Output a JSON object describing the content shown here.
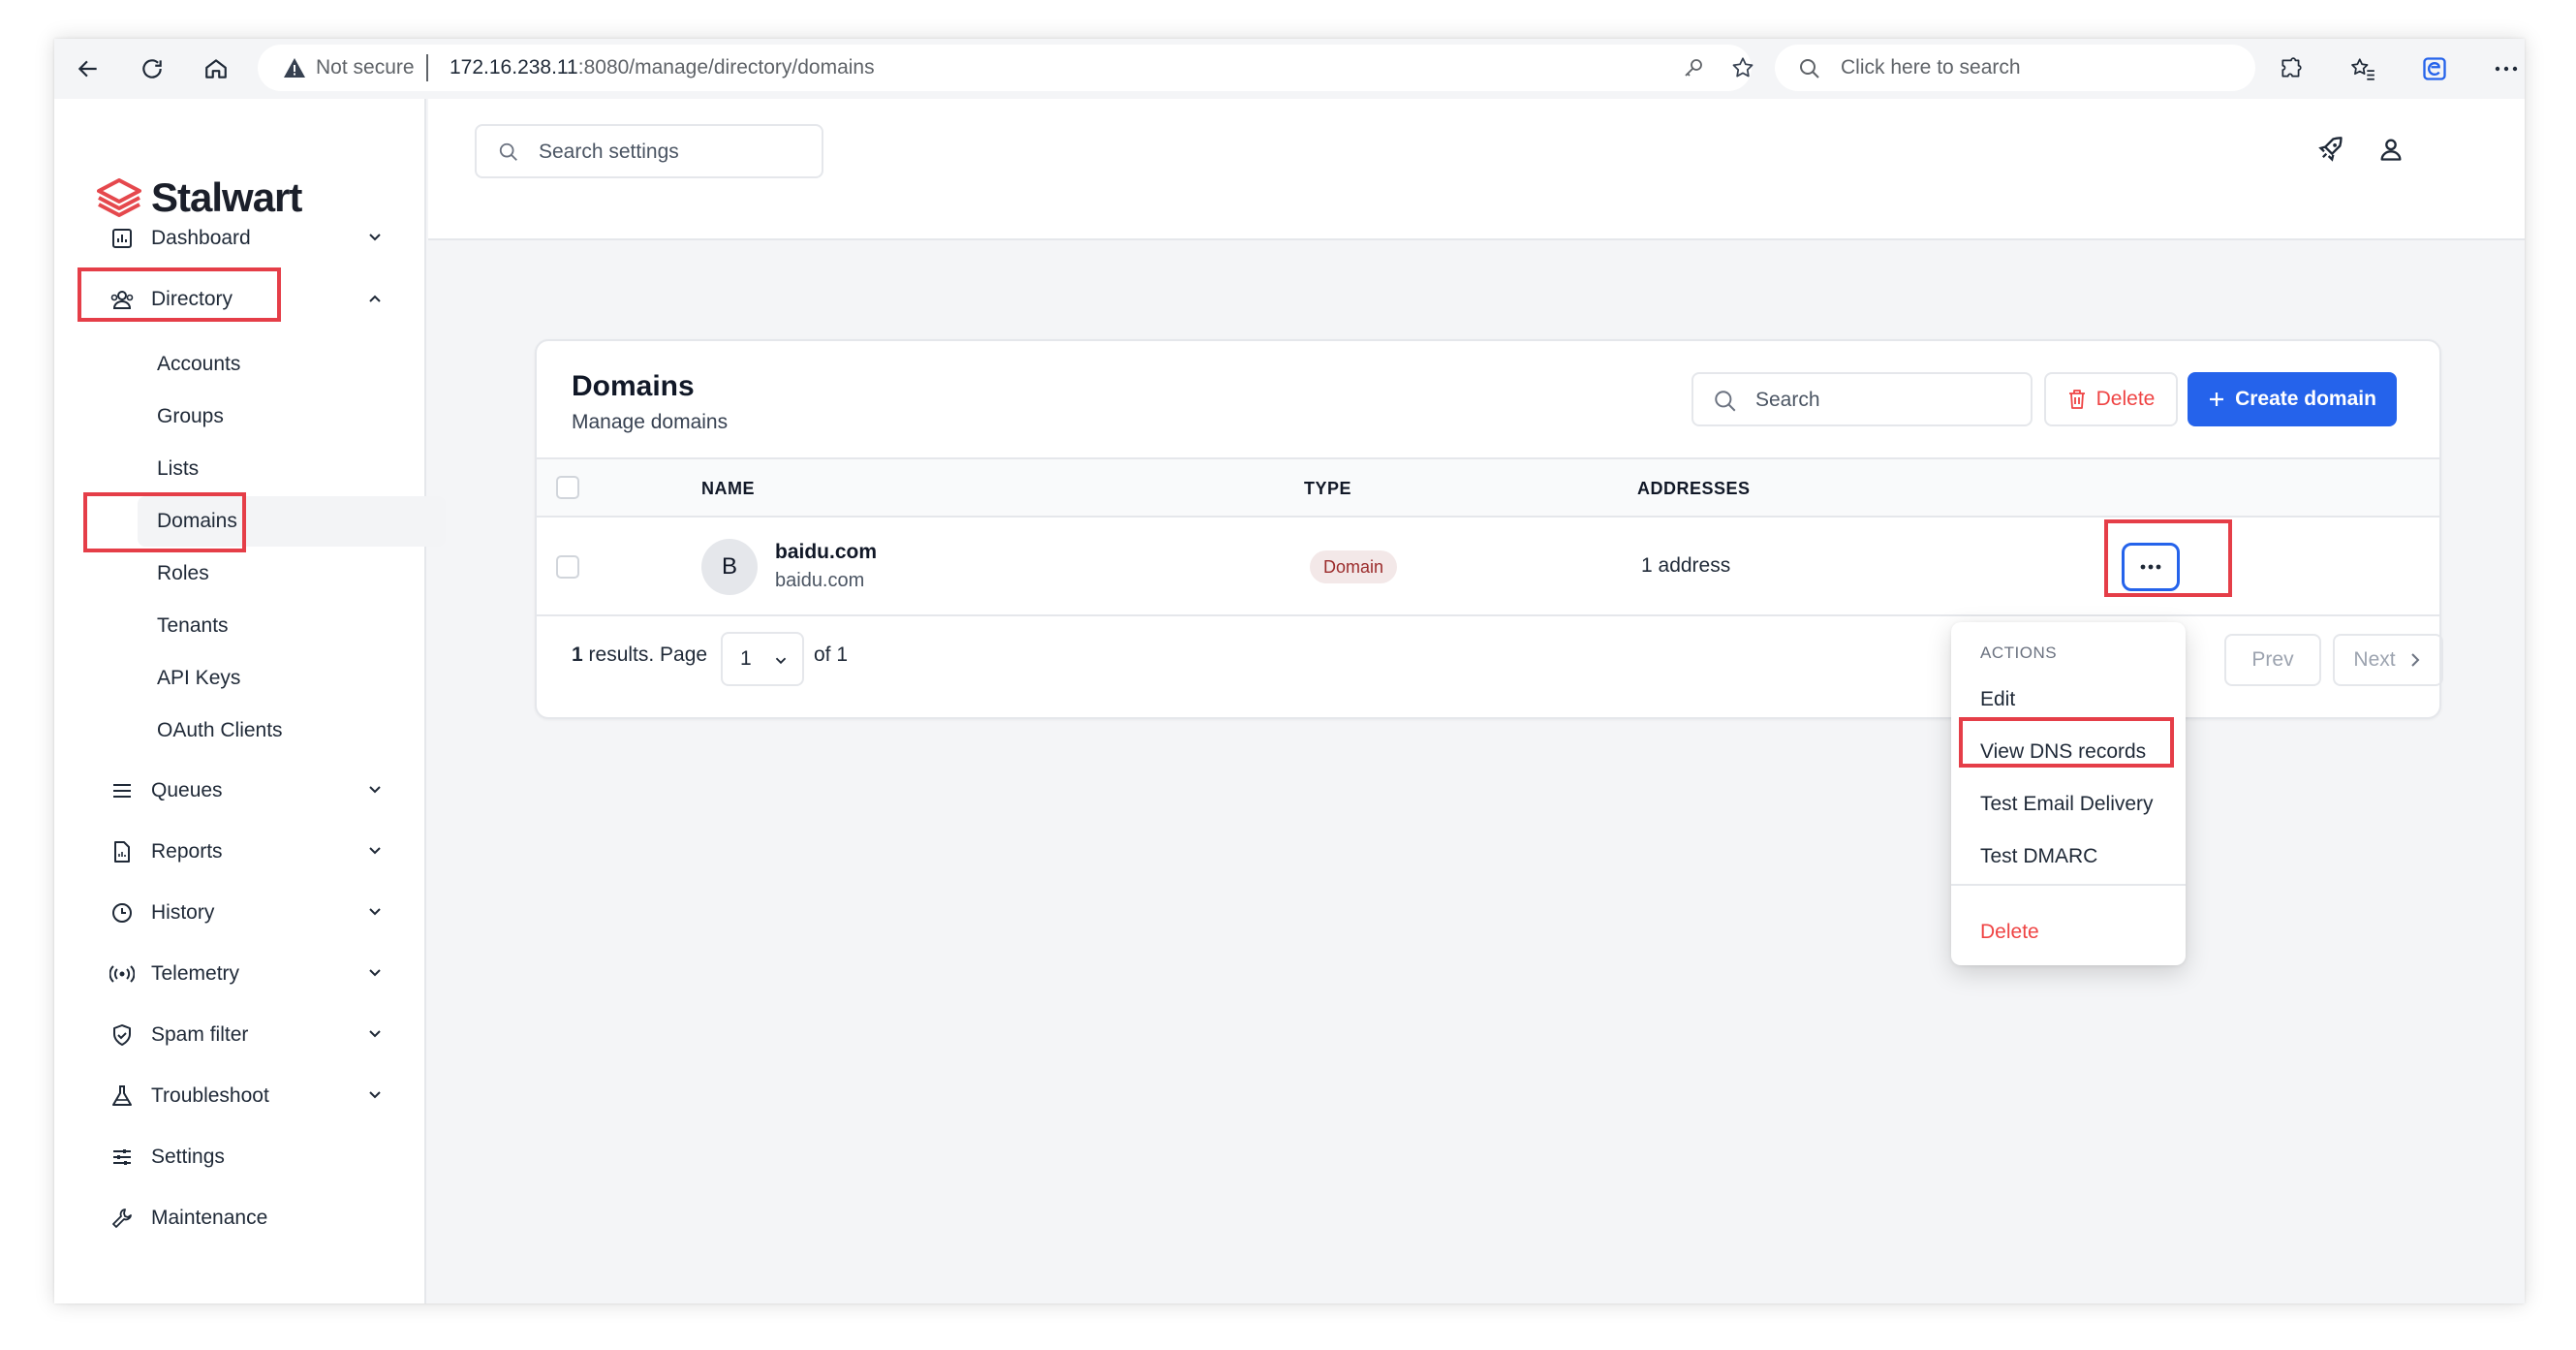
{
  "browser": {
    "security_label": "Not secure",
    "url_host": "172.16.238.11",
    "url_rest": ":8080/manage/directory/domains",
    "search_placeholder": "Click here to search"
  },
  "app": {
    "brand": "Stalwart",
    "settings_search_placeholder": "Search settings"
  },
  "sidebar": {
    "dashboard": "Dashboard",
    "directory": "Directory",
    "sub_items": [
      "Accounts",
      "Groups",
      "Lists",
      "Domains",
      "Roles",
      "Tenants",
      "API Keys",
      "OAuth Clients"
    ],
    "queues": "Queues",
    "reports": "Reports",
    "history": "History",
    "telemetry": "Telemetry",
    "spam_filter": "Spam filter",
    "troubleshoot": "Troubleshoot",
    "settings": "Settings",
    "maintenance": "Maintenance"
  },
  "domains": {
    "title": "Domains",
    "subtitle": "Manage domains",
    "search_placeholder": "Search",
    "delete_label": "Delete",
    "create_label": "Create domain",
    "columns": [
      "NAME",
      "TYPE",
      "ADDRESSES"
    ],
    "rows": [
      {
        "avatar": "B",
        "name": "baidu.com",
        "sub": "baidu.com",
        "type": "Domain",
        "addresses": "1 address"
      }
    ],
    "pagination": {
      "results_count": "1",
      "results_text": "results. Page",
      "page": "1",
      "of_text": "of 1",
      "prev": "Prev",
      "next": "Next"
    }
  },
  "menu": {
    "header": "ACTIONS",
    "items": [
      "Edit",
      "View DNS records",
      "Test Email Delivery",
      "Test DMARC"
    ],
    "delete": "Delete"
  },
  "colors": {
    "accent": "#2563eb",
    "danger": "#ef4444",
    "brand_logo": "#e5484d",
    "highlight": "#e53e48"
  }
}
